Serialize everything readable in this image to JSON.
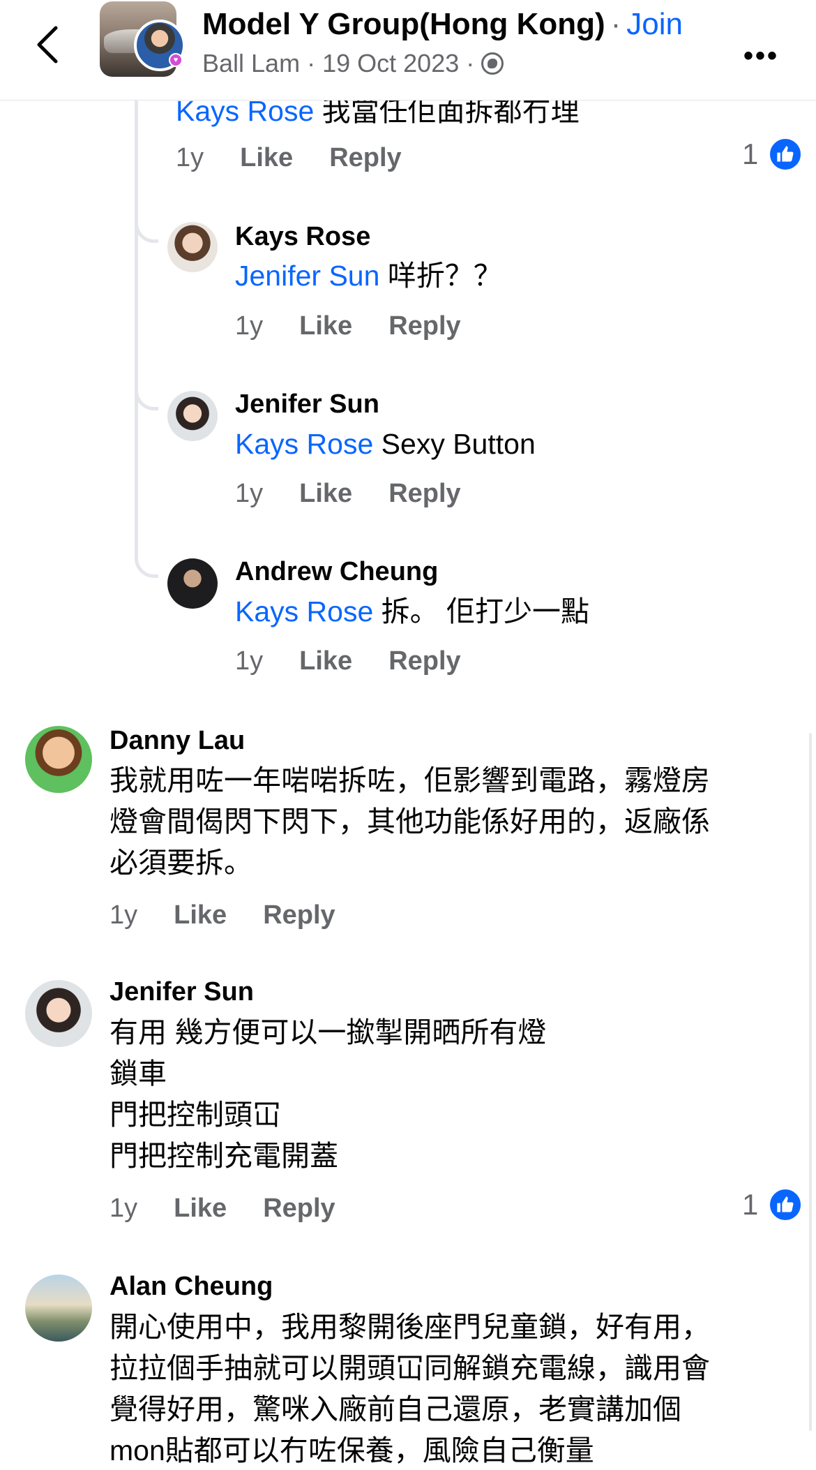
{
  "header": {
    "group_name": "Model Y Group(Hong Kong)",
    "separator": "·",
    "join_label": "Join",
    "author": "Ball Lam",
    "date": "19 Oct 2023",
    "icons": [
      "back-arrow-icon",
      "globe-icon",
      "more-icon"
    ]
  },
  "top_comment": {
    "mention": "Kays Rose",
    "text": "我當任佢面拆都冇理",
    "time": "1y",
    "like_label": "Like",
    "reply_label": "Reply",
    "reactions": "1"
  },
  "replies": [
    {
      "author": "Kays Rose",
      "mention": "Jenifer Sun",
      "text": "咩折？？",
      "time": "1y",
      "like_label": "Like",
      "reply_label": "Reply"
    },
    {
      "author": "Jenifer Sun",
      "mention": "Kays Rose",
      "text": "Sexy Button",
      "time": "1y",
      "like_label": "Like",
      "reply_label": "Reply"
    },
    {
      "author": "Andrew Cheung",
      "mention": "Kays Rose",
      "text": "拆。 佢打少一點",
      "time": "1y",
      "like_label": "Like",
      "reply_label": "Reply"
    }
  ],
  "comments": [
    {
      "author": "Danny Lau",
      "lines": [
        "我就用咗一年啱啱拆咗，佢影響到電路，霧燈房",
        "燈會間偈閃下閃下，其他功能係好用的，返廠係",
        "必須要拆。"
      ],
      "time": "1y",
      "like_label": "Like",
      "reply_label": "Reply"
    },
    {
      "author": "Jenifer Sun",
      "lines": [
        "有用 幾方便可以一撳掣開晒所有燈",
        "鎖車",
        "門把控制頭冚",
        "門把控制充電開蓋"
      ],
      "time": "1y",
      "like_label": "Like",
      "reply_label": "Reply",
      "reactions": "1"
    },
    {
      "author": "Alan Cheung",
      "lines": [
        "開心使用中，我用黎開後座門兒童鎖，好有用，",
        "拉拉個手抽就可以開頭冚同解鎖充電線，識用會",
        "覺得好用，驚咪入廠前自己還原，老實講加個",
        "mon貼都可以冇咗保養，風險自己衡量"
      ],
      "time": "",
      "like_label": "",
      "reply_label": ""
    }
  ],
  "colors": {
    "link": "#0866ff",
    "secondary": "#65676b",
    "thread": "#e4e6eb"
  }
}
